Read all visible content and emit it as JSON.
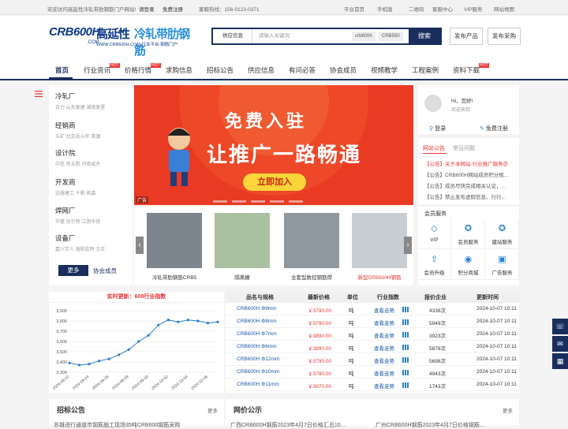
{
  "topbar": {
    "welcome": "欢迎访问高延性冷轧带肋钢筋门户网站!",
    "login": "请登录",
    "register": "免费注册",
    "hotline": "客服热线：156-0123-0371",
    "links": [
      "平台首页",
      "手机版",
      "二维码",
      "客服中心",
      "VIP服务",
      "网站地图"
    ]
  },
  "logo": {
    "brand": "CRB600H",
    "name1": "高延性",
    "name2": "冷轧带肋钢筋",
    "domain": ".COM",
    "url": "WWW.CRB600H.COM 行业平台·钢筋门户"
  },
  "search": {
    "category": "供应信息",
    "placeholder": "请输入关键词",
    "tags": [
      "crb600h",
      "CRB550"
    ],
    "button": "搜索"
  },
  "header_buttons": [
    "发布产品",
    "发布采购"
  ],
  "nav": {
    "items": [
      "首页",
      "行业资讯",
      "价格行情",
      "求购信息",
      "招标公告",
      "供应信息",
      "有问必答",
      "协会成员",
      "视频教学",
      "工程案例",
      "资料下载"
    ],
    "hot": "HOT"
  },
  "categories": [
    {
      "title": "冷轧厂",
      "subs": "合力  山东复建  湖南复星"
    },
    {
      "title": "经销商",
      "subs": "五矿  北京吾元年  首源"
    },
    {
      "title": "设计院",
      "subs": "中信  铁五院  河南城乡"
    },
    {
      "title": "开发商",
      "subs": "远睿建工  千帆  拓森"
    },
    {
      "title": "焊网厂",
      "subs": "华盛  汝尔特  江阴华良"
    },
    {
      "title": "设备厂",
      "subs": "嘉兴宇人  洛阳宏特  方正"
    }
  ],
  "left_more": "更多",
  "left_member": "协会成员",
  "banner": {
    "title": "免费入驻",
    "slogan": "让推广一路畅通",
    "button": "立即加入",
    "ad": "广告"
  },
  "products": [
    "冷轧带肋钢筋CRB5",
    "隔离栅",
    "全套型数控钢筋焊",
    "新型CRB600H钢筋"
  ],
  "user": {
    "greeting": "Hi，您好!",
    "welcome": "欢迎来到",
    "login": "登录",
    "register": "免费注册"
  },
  "notice": {
    "tabs": [
      "网站公告",
      "常见问题"
    ],
    "items": [
      "【公告】关于本网站·行业推广服务亦",
      "【公告】CRB600H网站成员积分规...",
      "【公告】成员尽快完成相关认证，...",
      "【公告】禁止发布虚假信息、行行..."
    ]
  },
  "services": {
    "title": "会员服务",
    "items": [
      {
        "label": "VIP",
        "icon": "diamond-icon"
      },
      {
        "label": "会员服务",
        "icon": "medal-icon"
      },
      {
        "label": "建站服务",
        "icon": "medal2-icon"
      },
      {
        "label": "会员升级",
        "icon": "upgrade-icon"
      },
      {
        "label": "积分商城",
        "icon": "coins-icon"
      },
      {
        "label": "广告服务",
        "icon": "ad-icon"
      }
    ]
  },
  "price": {
    "realtime_label": "实时更新：600行业指数",
    "headers": [
      "品名与规格",
      "最新价格",
      "单位",
      "行业指数",
      "报价企业",
      "更新时间"
    ],
    "rows": [
      {
        "name": "CRB600H Φ9mm",
        "price": "￥3790.00",
        "unit": "吨",
        "trend": "查看走势",
        "count": "4338次",
        "time": "2024-10-07 10:11"
      },
      {
        "name": "CRB600H Φ8mm",
        "price": "￥3790.00",
        "unit": "吨",
        "trend": "查看走势",
        "count": "5949次",
        "time": "2024-10-07 10:11"
      },
      {
        "name": "CRB600H Φ7mm",
        "price": "￥3890.00",
        "unit": "吨",
        "trend": "查看走势",
        "count": "3923次",
        "time": "2024-10-07 10:11"
      },
      {
        "name": "CRB600H Φ6mm",
        "price": "￥3990.00",
        "unit": "吨",
        "trend": "查看走势",
        "count": "5878次",
        "time": "2024-10-07 10:11"
      },
      {
        "name": "CRB600H Φ12mm",
        "price": "￥3790.00",
        "unit": "吨",
        "trend": "查看走势",
        "count": "5698次",
        "time": "2024-10-07 10:11"
      },
      {
        "name": "CRB600H Φ10mm",
        "price": "￥3790.00",
        "unit": "吨",
        "trend": "查看走势",
        "count": "4943次",
        "time": "2024-10-07 10:11"
      },
      {
        "name": "CRB600H Φ11mm",
        "price": "￥3970.00",
        "unit": "吨",
        "trend": "查看走势",
        "count": "1743次",
        "time": "2024-10-07 10:11"
      }
    ]
  },
  "chart_data": {
    "type": "line",
    "x": [
      "2024-09-22",
      "2024-09-23",
      "2024-09-24",
      "2024-09-25",
      "2024-09-26",
      "2024-09-27",
      "2024-09-28",
      "2024-09-29",
      "2024-09-30",
      "2024-10-01",
      "2024-10-02",
      "2024-10-03",
      "2024-10-04",
      "2024-10-05",
      "2024-10-06",
      "2024-10-07"
    ],
    "x_ticks": [
      "2024-09-22",
      "2024-09-24",
      "2024-09-26",
      "2024-09-28",
      "2024-09-30",
      "2024-10-02",
      "2024-10-04",
      "2024-10-06"
    ],
    "values": [
      3390,
      3370,
      3380,
      3410,
      3430,
      3470,
      3520,
      3600,
      3660,
      3760,
      3810,
      3790,
      3810,
      3800,
      3780,
      3790
    ],
    "ylim": [
      3300,
      3900
    ],
    "yticks": [
      3300,
      3400,
      3500,
      3600,
      3700,
      3800,
      3900
    ],
    "ytick_labels": [
      "3,300",
      "3,400",
      "3,500",
      "3,600",
      "3,700",
      "3,800",
      "3,900"
    ],
    "color": "#2a7fcf",
    "grid": true
  },
  "bottom": {
    "left": {
      "title": "招标公告",
      "more": "更多",
      "news": "苏雄进行通道市钢筋施工现场35吨CRB600钢筋采购"
    },
    "right": {
      "title": "网价公示",
      "more": "更多",
      "news": [
        "广西CRB600H钢筋2023年4月7日价格汇总10...",
        "广州CRB600H钢筋2023年4月7日价格钢筋..."
      ]
    }
  }
}
